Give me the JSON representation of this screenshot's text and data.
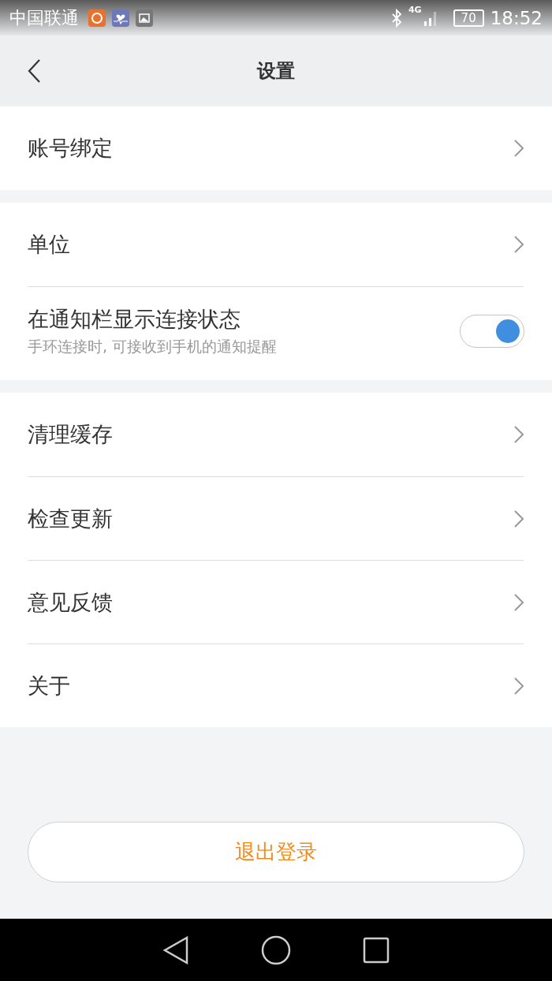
{
  "status_bar": {
    "carrier": "中国联通",
    "network": "4G",
    "battery": "70",
    "time": "18:52"
  },
  "header": {
    "title": "设置"
  },
  "sections": [
    {
      "items": [
        {
          "kind": "link",
          "label": "账号绑定"
        }
      ]
    },
    {
      "items": [
        {
          "kind": "link",
          "label": "单位"
        },
        {
          "kind": "toggle",
          "label": "在通知栏显示连接状态",
          "subtitle": "手环连接时, 可接收到手机的通知提醒",
          "on": true
        }
      ]
    },
    {
      "items": [
        {
          "kind": "link",
          "label": "清理缓存"
        },
        {
          "kind": "link",
          "label": "检查更新"
        },
        {
          "kind": "link",
          "label": "意见反馈"
        },
        {
          "kind": "link",
          "label": "关于"
        }
      ]
    }
  ],
  "logout_button": "退出登录"
}
